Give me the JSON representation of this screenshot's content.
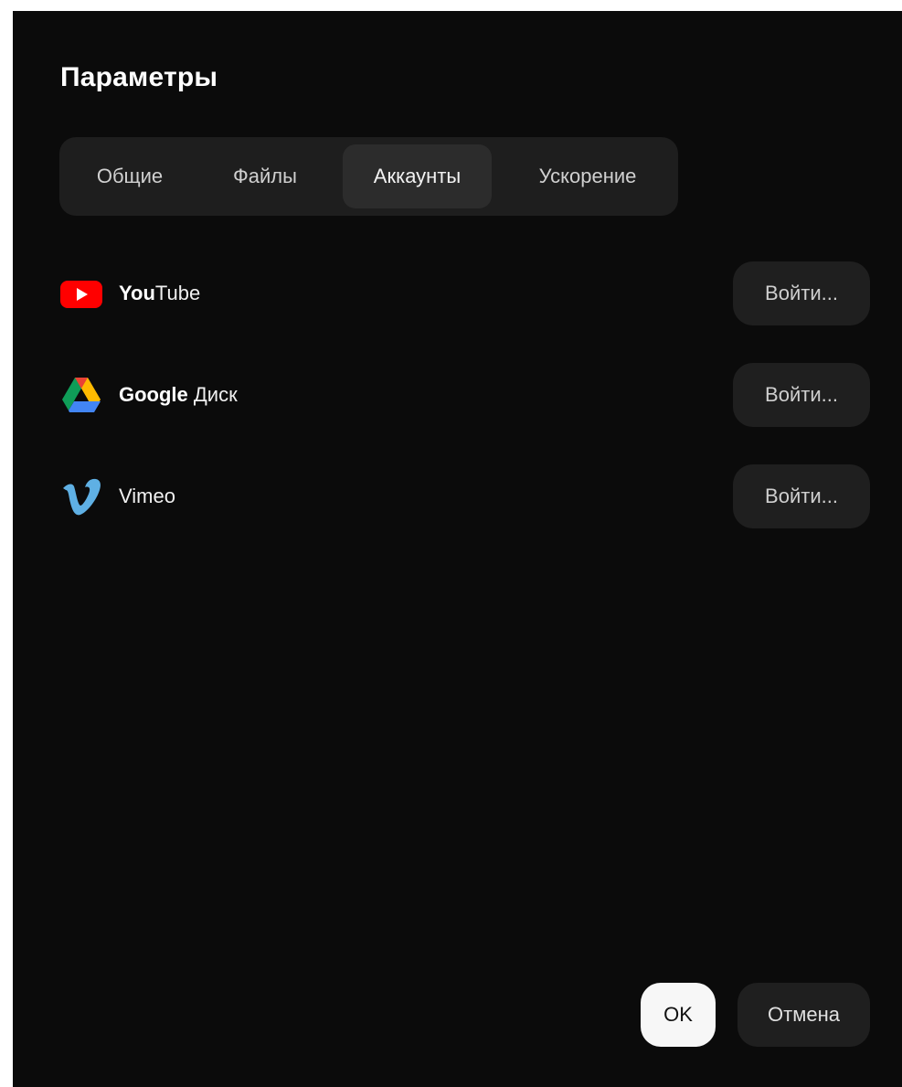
{
  "dialog": {
    "title": "Параметры"
  },
  "tabs": [
    {
      "label": "Общие",
      "active": false
    },
    {
      "label": "Файлы",
      "active": false
    },
    {
      "label": "Аккаунты",
      "active": true
    },
    {
      "label": "Ускорение",
      "active": false
    }
  ],
  "accounts": [
    {
      "service": "youtube",
      "name_bold": "You",
      "name_rest": "Tube",
      "icon": "youtube-icon",
      "button_label": "Войти..."
    },
    {
      "service": "google-drive",
      "name_bold": "Google",
      "name_rest": " Диск",
      "icon": "google-drive-icon",
      "button_label": "Войти..."
    },
    {
      "service": "vimeo",
      "name_bold": "",
      "name_rest": "Vimeo",
      "icon": "vimeo-icon",
      "button_label": "Войти..."
    }
  ],
  "footer": {
    "ok_label": "OK",
    "cancel_label": "Отмена"
  },
  "colors": {
    "background": "#0b0b0b",
    "tab_bar": "#1e1e1e",
    "tab_active": "#2c2c2c",
    "button": "#1f1f1f",
    "ok_button": "#f7f7f7",
    "youtube_red": "#ff0000",
    "vimeo_blue": "#5fb0e4"
  }
}
